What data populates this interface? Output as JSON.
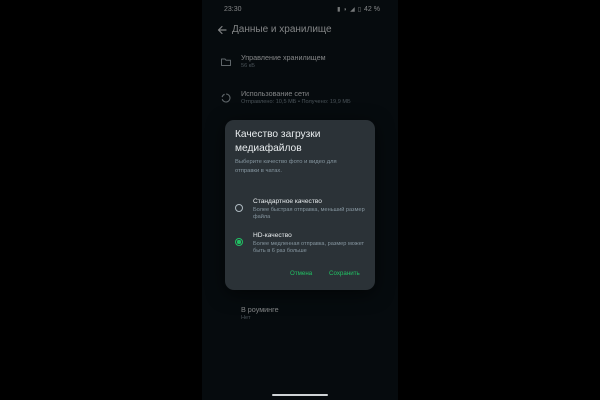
{
  "status_bar": {
    "time": "23:30",
    "battery": "42 %",
    "icons": [
      "sim-icon",
      "wifi-icon",
      "signal-icon",
      "battery-icon"
    ]
  },
  "header": {
    "title": "Данные и хранилище",
    "back_icon": "arrow-left-icon"
  },
  "rows": [
    {
      "title": "Управление хранилищем",
      "subtitle": "56 кБ",
      "icon": "folder-icon"
    },
    {
      "title": "Использование сети",
      "subtitle": "Отправлено: 10,5 МБ • Получено: 19,9 МБ",
      "icon": "data-usage-icon"
    }
  ],
  "roaming": {
    "title": "В роуминге",
    "subtitle": "Нет"
  },
  "dialog": {
    "title": "Качество загрузки медиафайлов",
    "description": "Выберите качество фото и видео для отправки в чатах.",
    "options": [
      {
        "title": "Стандартное качество",
        "description": "Более быстрая отправка, меньший размер файла",
        "selected": false
      },
      {
        "title": "HD-качество",
        "description": "Более медленная отправка, размер может быть в 6 раз больше",
        "selected": true
      }
    ],
    "cancel_label": "Отмена",
    "save_label": "Сохранить"
  },
  "colors": {
    "accent": "#21c063",
    "background": "#0b141a",
    "dialog": "#2b3237",
    "secondary_text": "#8696a0"
  }
}
